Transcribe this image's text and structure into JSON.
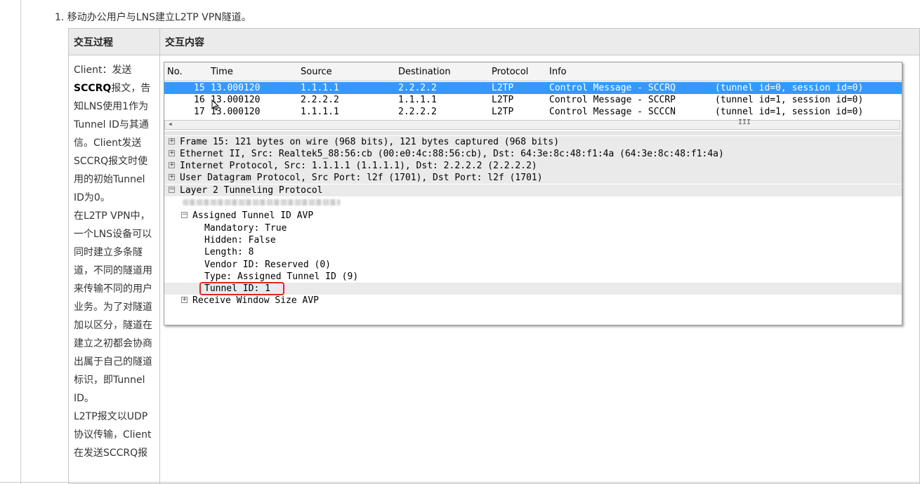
{
  "heading": "1. 移动办公用户与LNS建立L2TP VPN隧道。",
  "table": {
    "col1_header": "交互过程",
    "col2_header": "交互内容"
  },
  "left_text": {
    "p1_a": "Client：发送",
    "p1_b": "SCCRQ",
    "p1_c": "报文，告知LNS使用1作为Tunnel ID与其通信。Client发送SCCRQ报文时使用的初始Tunnel ID为0。",
    "p2": "在L2TP VPN中，一个LNS设备可以同时建立多条隧道，不同的隧道用来传输不同的用户业务。为了对隧道加以区分，隧道在建立之初都会协商出属于自己的隧道标识，即Tunnel ID。",
    "p3": "L2TP报文以UDP协议传输，Client在发送SCCRQ报"
  },
  "capture": {
    "columns": {
      "no": "No.",
      "time": "Time",
      "source": "Source",
      "destination": "Destination",
      "protocol": "Protocol",
      "info": "Info"
    },
    "packets": [
      {
        "no": "15",
        "time": "13.000120",
        "source": "1.1.1.1",
        "destination": "2.2.2.2",
        "protocol": "L2TP",
        "info": "Control Message - SCCRQ",
        "ids": "(tunnel id=0, session id=0)",
        "selected": true
      },
      {
        "no": "16",
        "time": "13.000120",
        "source": "2.2.2.2",
        "destination": "1.1.1.1",
        "protocol": "L2TP",
        "info": "Control Message - SCCRP",
        "ids": "(tunnel id=1, session id=0)",
        "selected": false
      },
      {
        "no": "17",
        "time": "13.000120",
        "source": "1.1.1.1",
        "destination": "2.2.2.2",
        "protocol": "L2TP",
        "info": "Control Message - SCCCN",
        "ids": "(tunnel id=1, session id=0)",
        "selected": false
      }
    ],
    "scroll_grip": "III",
    "details": {
      "frame": "Frame 15: 121 bytes on wire (968 bits), 121 bytes captured (968 bits)",
      "ethernet": "Ethernet II, Src: Realtek5_88:56:cb (00:e0:4c:88:56:cb), Dst: 64:3e:8c:48:f1:4a (64:3e:8c:48:f1:4a)",
      "ip": "Internet Protocol, Src: 1.1.1.1 (1.1.1.1), Dst: 2.2.2.2 (2.2.2.2)",
      "udp": "User Datagram Protocol, Src Port: l2f (1701), Dst Port: l2f (1701)",
      "l2tp": "Layer 2 Tunneling Protocol",
      "avp": "Assigned Tunnel ID AVP",
      "mandatory": "Mandatory: True",
      "hidden": "Hidden: False",
      "length": "Length: 8",
      "vendor": "Vendor ID: Reserved (0)",
      "type": "Type: Assigned Tunnel ID (9)",
      "tunnel_id": "Tunnel ID: 1",
      "rws": "Receive Window Size AVP"
    }
  },
  "colors": {
    "selection": "#3399ff",
    "highlight_box": "#e0281e",
    "header_bg": "#ebebeb"
  }
}
